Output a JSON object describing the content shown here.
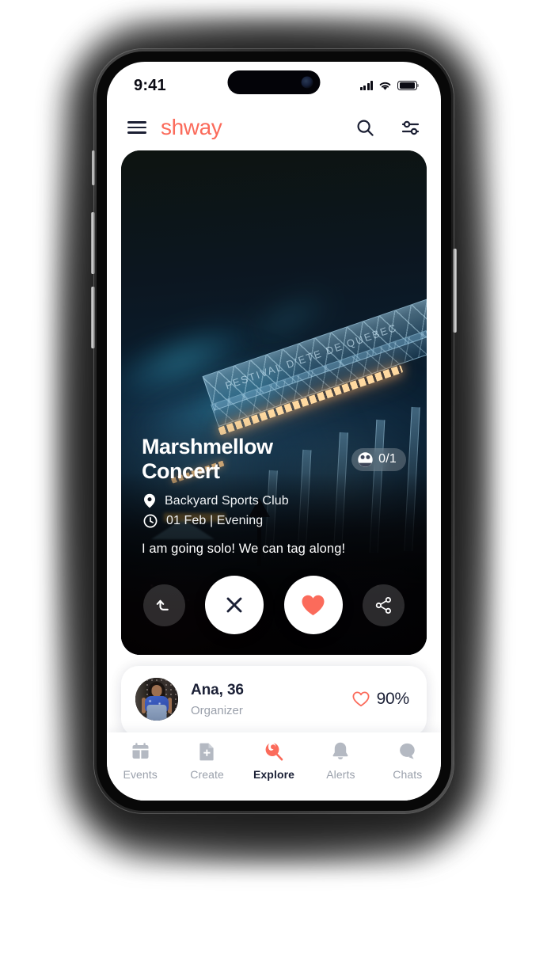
{
  "status_bar": {
    "time": "9:41",
    "signal_icon": "cellular-signal-icon",
    "wifi_icon": "wifi-icon",
    "battery_icon": "battery-full-icon"
  },
  "app_bar": {
    "menu_icon": "hamburger-menu-icon",
    "logo": "shway",
    "search_icon": "search-icon",
    "filter_icon": "filter-sliders-icon"
  },
  "event_card": {
    "title": "Marshmellow Concert",
    "attendee_badge": {
      "icon": "people-group-icon",
      "count": "0/1"
    },
    "location": {
      "icon": "location-pin-icon",
      "text": "Backyard Sports Club"
    },
    "datetime": {
      "icon": "clock-icon",
      "text": "01 Feb | Evening"
    },
    "description": "I am going solo! We can tag along!",
    "image_alt": "Night concert stage with blue smoke and crowd"
  },
  "actions": [
    {
      "name": "undo-button",
      "icon": "undo-arrow-icon",
      "style": "small-dark"
    },
    {
      "name": "reject-button",
      "icon": "close-x-icon",
      "style": "large-white"
    },
    {
      "name": "like-button",
      "icon": "heart-filled-icon",
      "style": "large-white"
    },
    {
      "name": "share-button",
      "icon": "share-icon",
      "style": "small-dark"
    }
  ],
  "organizer_card": {
    "avatar_icon": "user-avatar",
    "name": "Ana, 36",
    "role": "Organizer",
    "match": {
      "icon": "heart-outline-icon",
      "value": "90%"
    }
  },
  "bottom_nav": {
    "items": [
      {
        "label": "Events",
        "icon": "calendar-icon",
        "active": false
      },
      {
        "label": "Create",
        "icon": "document-plus-icon",
        "active": false
      },
      {
        "label": "Explore",
        "icon": "explore-search-icon",
        "active": true
      },
      {
        "label": "Alerts",
        "icon": "bell-icon",
        "active": false
      },
      {
        "label": "Chats",
        "icon": "chat-bubble-icon",
        "active": false
      }
    ]
  },
  "colors": {
    "brand": "#fb6b5b",
    "accent_heart": "#fb6b5b",
    "text_dark": "#1b2036",
    "text_muted": "#9aa0ab",
    "surface": "#ffffff"
  }
}
